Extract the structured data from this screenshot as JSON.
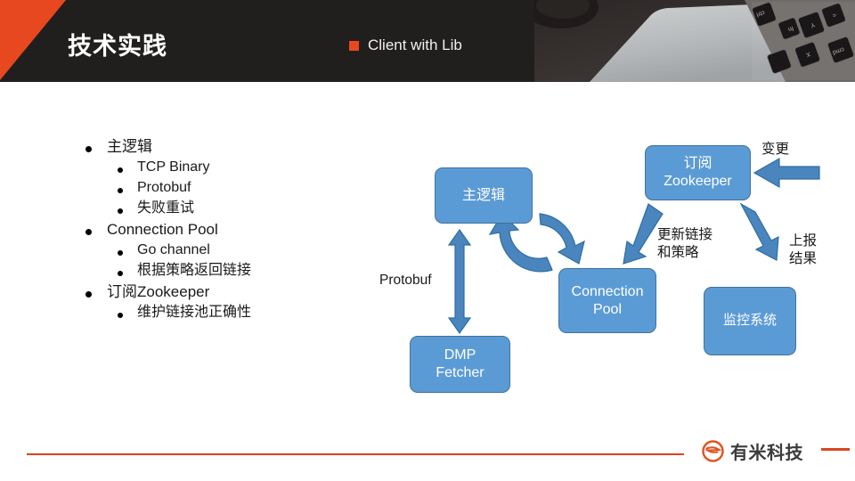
{
  "header": {
    "title": "技术实践",
    "subtitle": "Client with Lib",
    "bullet_icon": "square-bullet-icon",
    "photo_icon": "laptop-keyboard-photo",
    "bg_color": "#211f1e",
    "accent_color": "#e8481f"
  },
  "bullets": [
    {
      "level": 1,
      "label": "主逻辑"
    },
    {
      "level": 2,
      "label": "TCP Binary"
    },
    {
      "level": 2,
      "label": "Protobuf"
    },
    {
      "level": 2,
      "label": "失败重试"
    },
    {
      "level": 1,
      "label": "Connection Pool"
    },
    {
      "level": 2,
      "label": "Go channel"
    },
    {
      "level": 2,
      "label": "根据策略返回链接"
    },
    {
      "level": 1,
      "label": "订阅Zookeeper"
    },
    {
      "level": 2,
      "label": "维护链接池正确性"
    }
  ],
  "diagram": {
    "node_fill": "#5b9bd5",
    "node_border": "#41719c",
    "arrow_color": "#4a86bd",
    "nodes": {
      "main_logic": "主逻辑",
      "zookeeper": "订阅\nZookeeper",
      "connection_pool": "Connection\nPool",
      "dmp_fetcher": "DMP\nFetcher",
      "monitor": "监控系统"
    },
    "labels": {
      "protobuf": "Protobuf",
      "change": "变更",
      "update_link_policy": "更新链接\n和策略",
      "report_result": "上报\n结果"
    },
    "arrows": [
      {
        "name": "main-logic-to-dmp-bidirectional",
        "label": "Protobuf"
      },
      {
        "name": "main-logic-to-pool-curved",
        "label": ""
      },
      {
        "name": "pool-to-main-logic-curved",
        "label": ""
      },
      {
        "name": "zookeeper-to-pool",
        "label": "更新链接和策略"
      },
      {
        "name": "zookeeper-to-monitor",
        "label": "上报结果"
      },
      {
        "name": "external-to-zookeeper",
        "label": "变更"
      }
    ]
  },
  "footer": {
    "brand": "有米科技",
    "logo_icon": "youmi-circle-logo-icon",
    "line_color": "#d9451f"
  }
}
